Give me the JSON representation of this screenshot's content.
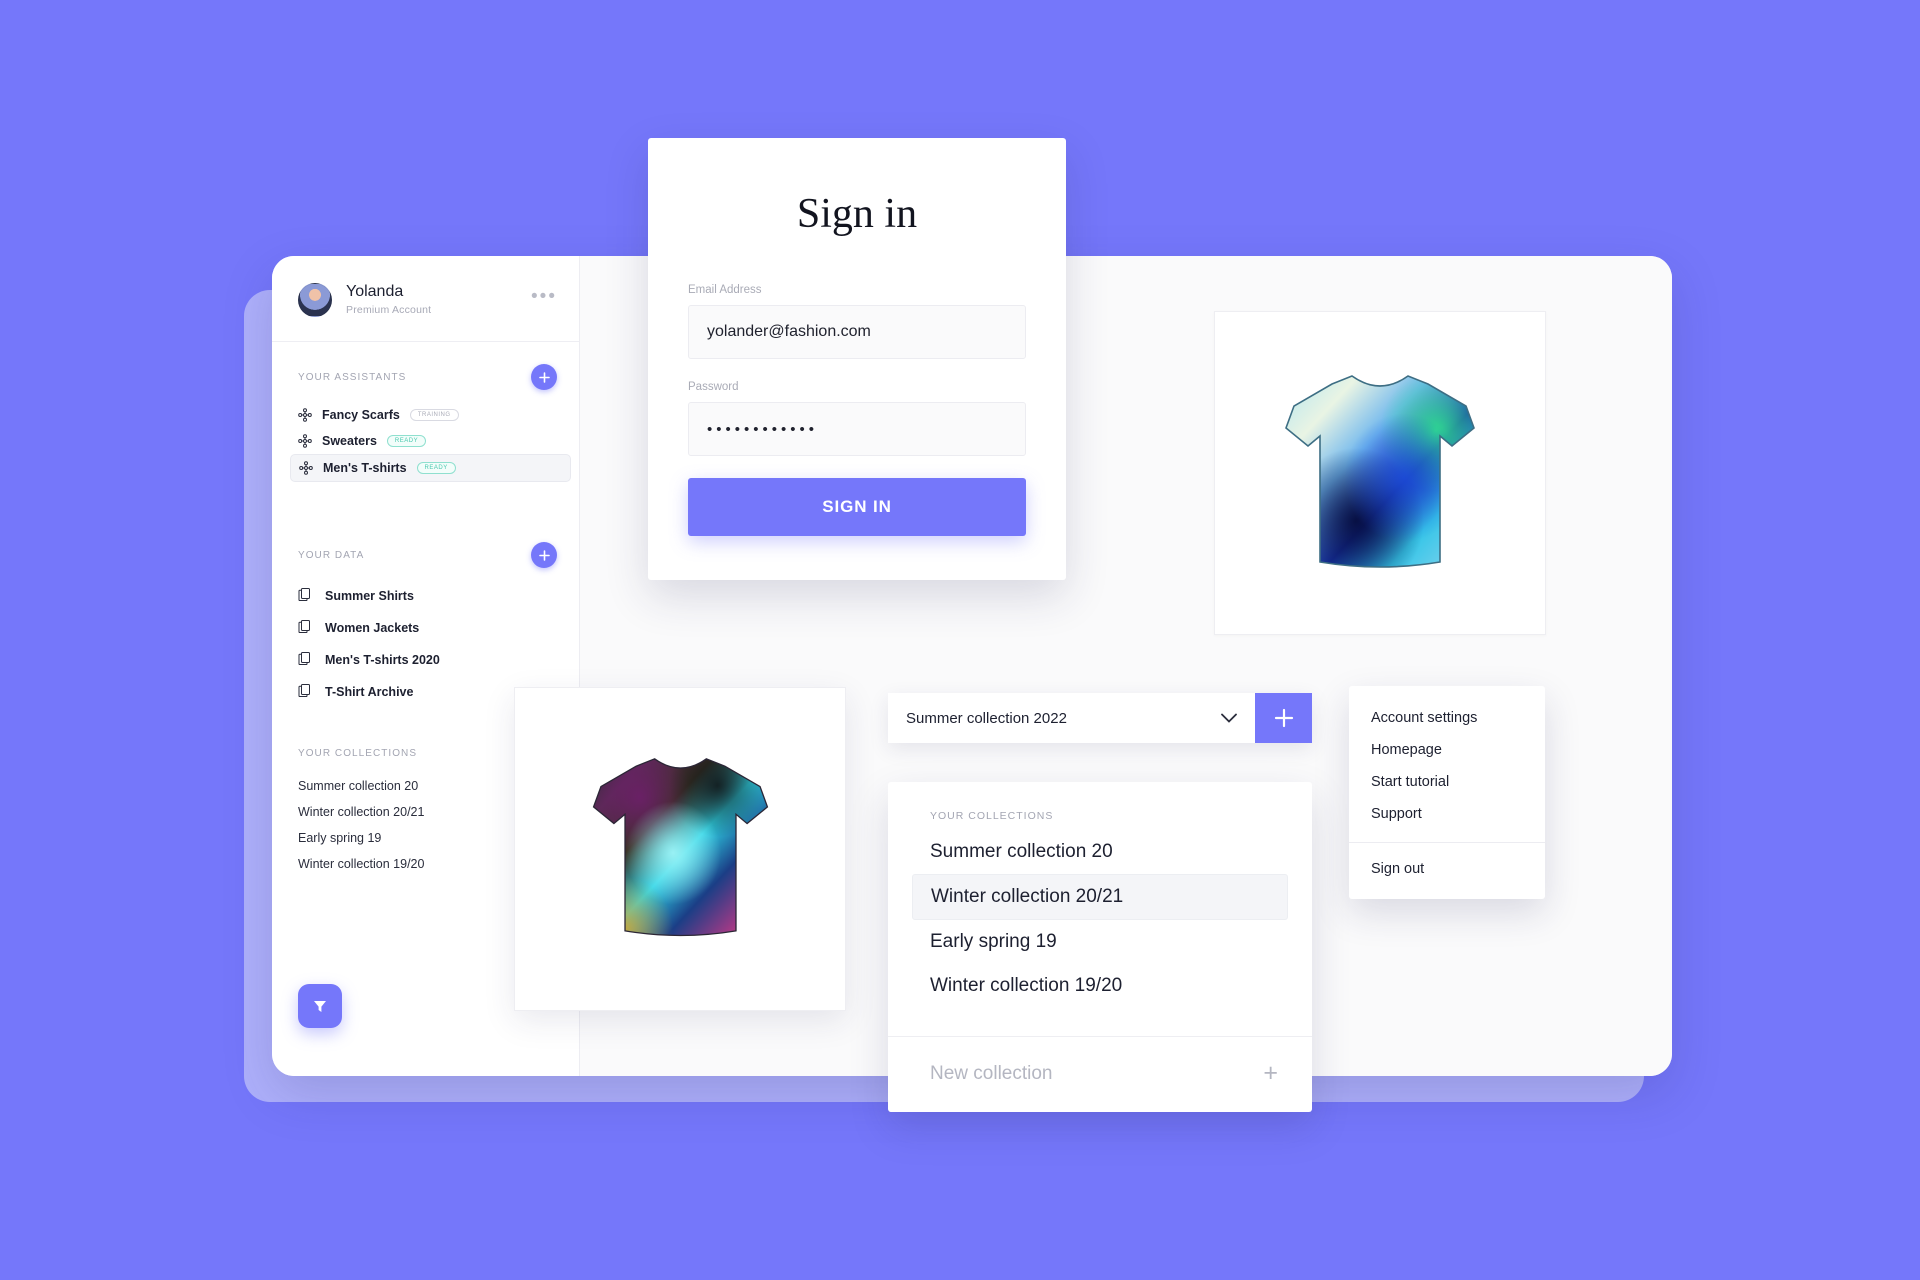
{
  "theme": {
    "accent": "#7577fa",
    "background": "#7577fa",
    "base_shadow": "#aeb0fb",
    "ready_badge": "#49c9ae"
  },
  "sidebar": {
    "profile": {
      "name": "Yolanda",
      "subtitle": "Premium Account",
      "menu_icon": "•••"
    },
    "assistants": {
      "title": "YOUR ASSISTANTS",
      "add_label": "+",
      "items": [
        {
          "label": "Fancy Scarfs",
          "badge": "TRAINING",
          "badge_type": "training",
          "active": false
        },
        {
          "label": "Sweaters",
          "badge": "READY",
          "badge_type": "ready",
          "active": false
        },
        {
          "label": "Men's T-shirts",
          "badge": "READY",
          "badge_type": "ready",
          "active": true
        }
      ]
    },
    "data": {
      "title": "YOUR DATA",
      "add_label": "+",
      "items": [
        {
          "label": "Summer Shirts"
        },
        {
          "label": "Women Jackets"
        },
        {
          "label": "Men's T-shirts 2020"
        },
        {
          "label": "T-Shirt Archive"
        }
      ]
    },
    "collections": {
      "title": "YOUR COLLECTIONS",
      "items": [
        {
          "label": "Summer collection 20"
        },
        {
          "label": "Winter collection 20/21"
        },
        {
          "label": "Early spring 19"
        },
        {
          "label": "Winter collection 19/20"
        }
      ]
    },
    "filter_button": {
      "icon": "filter-funnel-icon"
    }
  },
  "signin": {
    "title": "Sign in",
    "email_label": "Email Address",
    "email_value": "yolander@fashion.com",
    "email_placeholder": "Email Address",
    "password_label": "Password",
    "password_value": "••••••••••••",
    "password_placeholder": "Password",
    "submit_label": "SIGN IN"
  },
  "collection_select": {
    "value": "Summer collection 2022",
    "chevron": "chevron-down-icon",
    "add_label": "+"
  },
  "collections_dropdown": {
    "header": "YOUR COLLECTIONS",
    "items": [
      {
        "label": "Summer collection 20",
        "selected": false
      },
      {
        "label": "Winter collection 20/21",
        "selected": true
      },
      {
        "label": "Early spring 19",
        "selected": false
      },
      {
        "label": "Winter collection 19/20",
        "selected": false
      }
    ],
    "new_collection_label": "New collection",
    "new_collection_plus": "+"
  },
  "account_menu": {
    "items": [
      {
        "label": "Account settings"
      },
      {
        "label": "Homepage"
      },
      {
        "label": "Start tutorial"
      },
      {
        "label": "Support"
      }
    ],
    "sign_out_label": "Sign out"
  },
  "products": {
    "tee_top": {
      "name": "blue-green-gradient-tshirt"
    },
    "tee_bottom": {
      "name": "iridescent-tiedye-tshirt"
    }
  }
}
